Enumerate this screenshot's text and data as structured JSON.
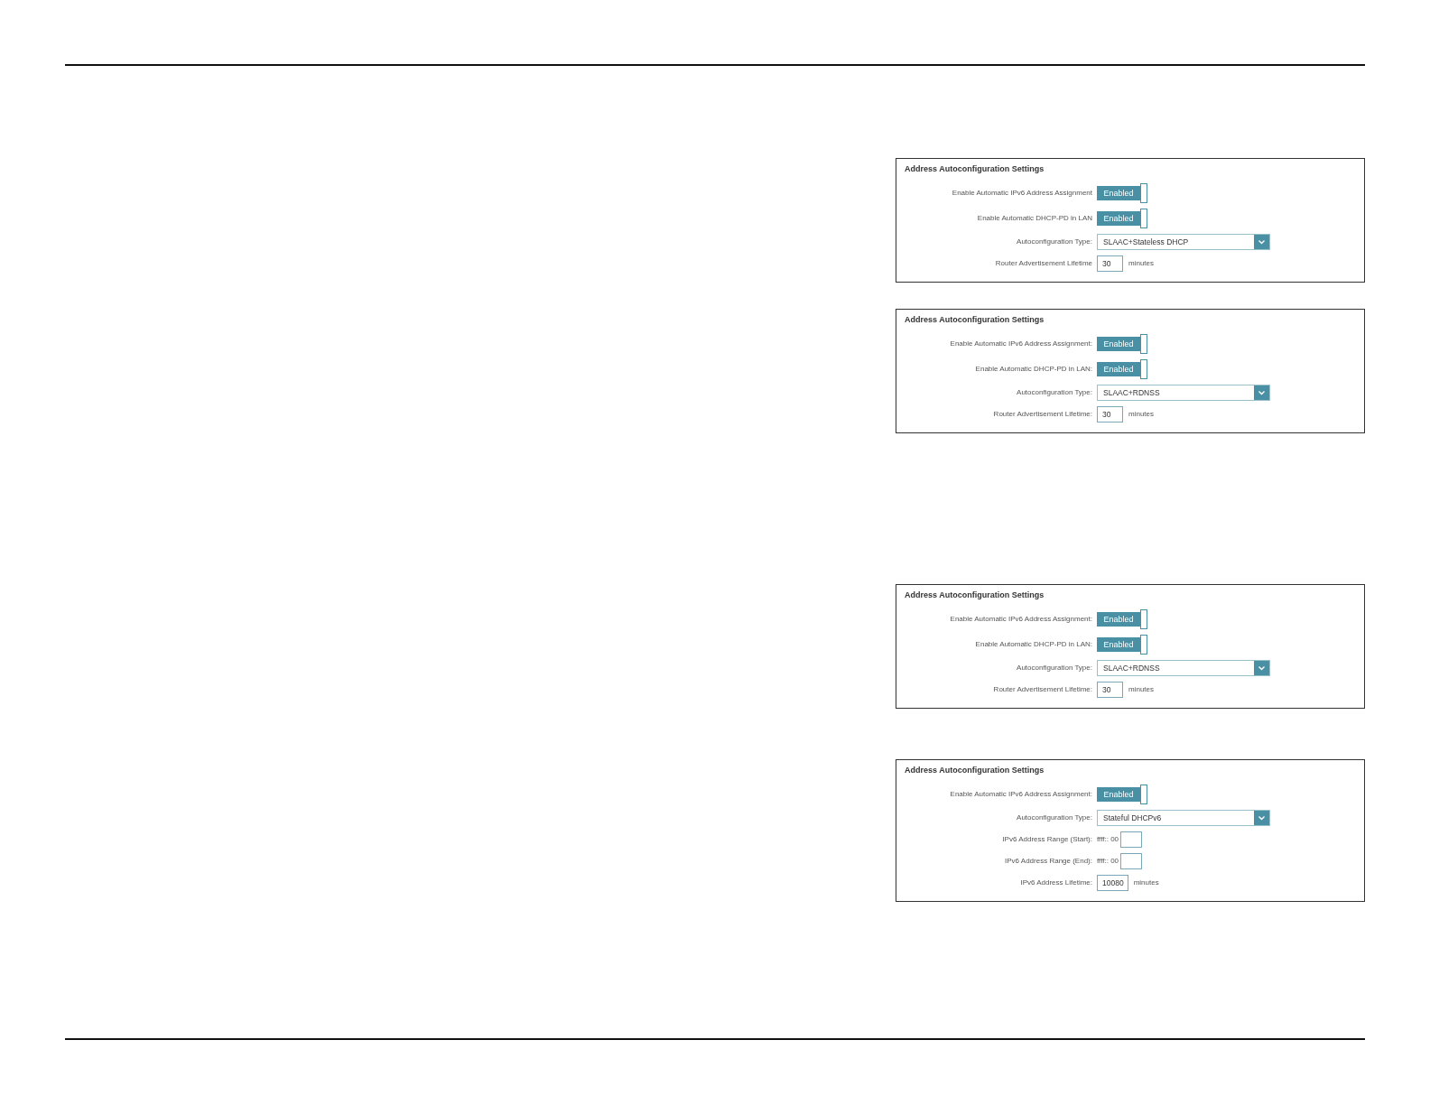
{
  "panels": [
    {
      "title": "Address Autoconfiguration Settings",
      "rows": [
        {
          "kind": "toggle",
          "label": "Enable Automatic IPv6 Address Assignment",
          "value": "Enabled",
          "on": true
        },
        {
          "kind": "toggle",
          "label": "Enable Automatic DHCP-PD in LAN",
          "value": "Enabled",
          "on": true
        },
        {
          "kind": "select",
          "label": "Autoconfiguration Type:",
          "value": "SLAAC+Stateless DHCP"
        },
        {
          "kind": "number",
          "label": "Router Advertisement Lifetime",
          "value": "30",
          "unit": "minutes"
        }
      ]
    },
    {
      "title": "Address Autoconfiguration Settings",
      "rows": [
        {
          "kind": "toggle",
          "label": "Enable Automatic IPv6 Address Assignment:",
          "value": "Enabled",
          "on": true
        },
        {
          "kind": "toggle",
          "label": "Enable Automatic DHCP-PD in LAN:",
          "value": "Enabled",
          "on": true
        },
        {
          "kind": "select",
          "label": "Autoconfiguration Type:",
          "value": "SLAAC+RDNSS"
        },
        {
          "kind": "number",
          "label": "Router Advertisement Lifetime:",
          "value": "30",
          "unit": "minutes"
        }
      ]
    },
    {
      "title": "Address Autoconfiguration Settings",
      "rows": [
        {
          "kind": "toggle",
          "label": "Enable Automatic IPv6 Address Assignment:",
          "value": "Enabled",
          "on": true
        },
        {
          "kind": "toggle",
          "label": "Enable Automatic DHCP-PD in LAN:",
          "value": "Enabled",
          "on": true
        },
        {
          "kind": "select",
          "label": "Autoconfiguration Type:",
          "value": "SLAAC+RDNSS"
        },
        {
          "kind": "number",
          "label": "Router Advertisement Lifetime:",
          "value": "30",
          "unit": "minutes"
        }
      ]
    },
    {
      "title": "Address Autoconfiguration Settings",
      "rows": [
        {
          "kind": "toggle",
          "label": "Enable Automatic IPv6 Address Assignment:",
          "value": "Enabled",
          "on": true
        },
        {
          "kind": "select",
          "label": "Autoconfiguration Type:",
          "value": "Stateful DHCPv6"
        },
        {
          "kind": "range",
          "label": "IPv6 Address Range (Start):",
          "prefix": "ffff:: 00"
        },
        {
          "kind": "range",
          "label": "IPv6 Address Range (End):",
          "prefix": "ffff:: 00"
        },
        {
          "kind": "number",
          "label": "IPv6 Address Lifetime:",
          "value": "10080",
          "unit": "minutes"
        }
      ]
    }
  ]
}
